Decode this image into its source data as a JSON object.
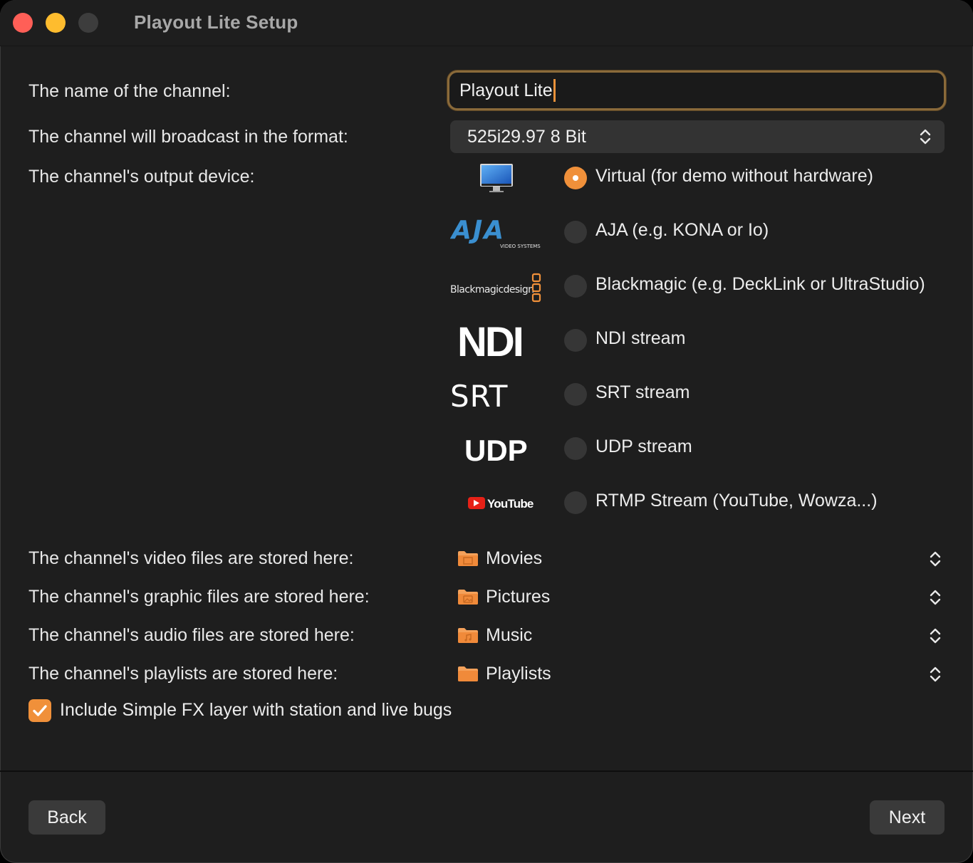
{
  "window": {
    "title": "Playout Lite Setup"
  },
  "form": {
    "name_label": "The name of the channel:",
    "name_value": "Playout Lite",
    "format_label": "The channel will broadcast in the format:",
    "format_value": "525i29.97 8 Bit",
    "device_label": "The channel's output device:"
  },
  "devices": [
    {
      "logo": "monitor-icon",
      "label": "Virtual (for demo without hardware)",
      "selected": true
    },
    {
      "logo": "AJA",
      "logo_sub": "VIDEO SYSTEMS",
      "label": "AJA (e.g. KONA or Io)",
      "selected": false
    },
    {
      "logo": "Blackmagicdesign",
      "label": "Blackmagic (e.g. DeckLink or UltraStudio)",
      "selected": false
    },
    {
      "logo": "NDI",
      "label": "NDI stream",
      "selected": false
    },
    {
      "logo": "SRT",
      "label": "SRT stream",
      "selected": false
    },
    {
      "logo": "UDP",
      "label": "UDP stream",
      "selected": false
    },
    {
      "logo": "YouTube",
      "label": "RTMP Stream (YouTube, Wowza...)",
      "selected": false
    }
  ],
  "storage": [
    {
      "label": "The channel's video files are stored here:",
      "folder": "Movies",
      "icon": "movies-folder-icon"
    },
    {
      "label": "The channel's graphic files are stored here:",
      "folder": "Pictures",
      "icon": "pictures-folder-icon"
    },
    {
      "label": "The channel's audio files are stored here:",
      "folder": "Music",
      "icon": "music-folder-icon"
    },
    {
      "label": "The channel's playlists are stored here:",
      "folder": "Playlists",
      "icon": "folder-icon"
    }
  ],
  "simple_fx": {
    "label": "Include Simple FX layer with station and live bugs",
    "checked": true
  },
  "buttons": {
    "back": "Back",
    "next": "Next"
  },
  "colors": {
    "accent": "#f0903a",
    "background": "#1e1e1e"
  }
}
